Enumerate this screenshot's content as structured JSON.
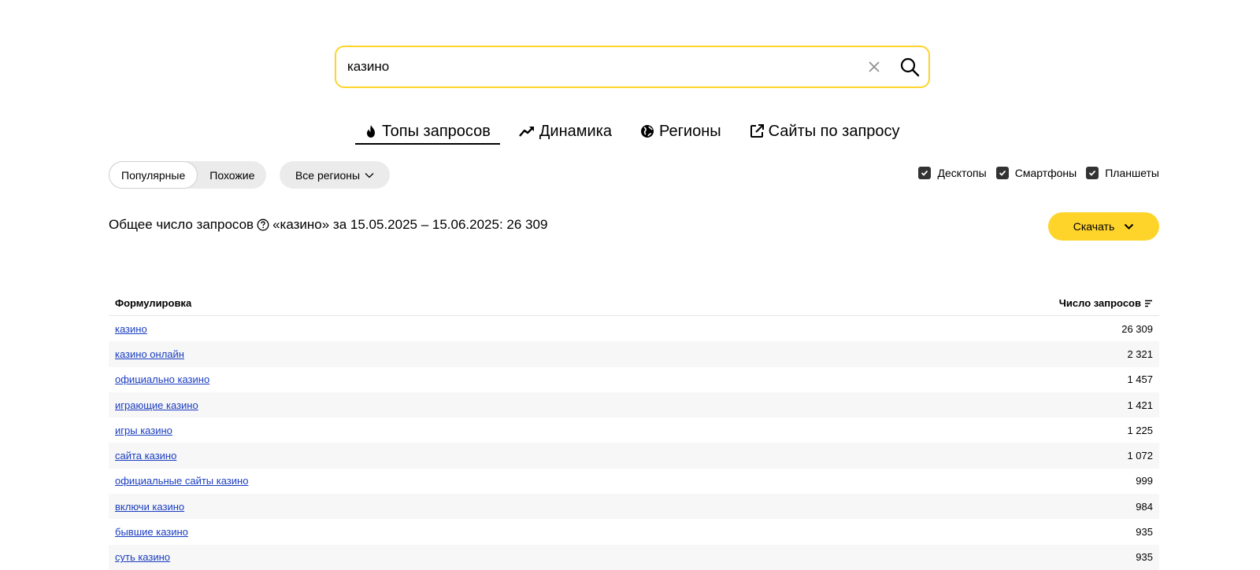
{
  "search": {
    "value": "казино",
    "placeholder": ""
  },
  "tabs": [
    {
      "label": "Топы запросов",
      "icon": "fire-icon",
      "active": true
    },
    {
      "label": "Динамика",
      "icon": "trend-up-icon",
      "active": false
    },
    {
      "label": "Регионы",
      "icon": "globe-icon",
      "active": false
    },
    {
      "label": "Сайты по запросу",
      "icon": "external-link-icon",
      "active": false
    }
  ],
  "filters": {
    "segment": [
      {
        "label": "Популярные",
        "active": true
      },
      {
        "label": "Похожие",
        "active": false
      }
    ],
    "region": "Все регионы",
    "devices": [
      {
        "label": "Десктопы",
        "checked": true
      },
      {
        "label": "Смартфоны",
        "checked": true
      },
      {
        "label": "Планшеты",
        "checked": true
      }
    ]
  },
  "summary": {
    "label": "Общее число запросов",
    "text": "«казино» за 15.05.2025 – 15.06.2025: 26 309"
  },
  "download": {
    "label": "Скачать"
  },
  "table": {
    "headers": {
      "phrase": "Формулировка",
      "count": "Число запросов"
    },
    "rows": [
      {
        "phrase": "казино",
        "count": "26 309"
      },
      {
        "phrase": "казино онлайн",
        "count": "2 321"
      },
      {
        "phrase": "официально казино",
        "count": "1 457"
      },
      {
        "phrase": "играющие казино",
        "count": "1 421"
      },
      {
        "phrase": "игры казино",
        "count": "1 225"
      },
      {
        "phrase": "сайта казино",
        "count": "1 072"
      },
      {
        "phrase": "официальные сайты казино",
        "count": "999"
      },
      {
        "phrase": "включи казино",
        "count": "984"
      },
      {
        "phrase": "бывшие казино",
        "count": "935"
      },
      {
        "phrase": "суть казино",
        "count": "935"
      }
    ]
  },
  "colors": {
    "accent": "#fed42b",
    "link": "#1a3dc1"
  }
}
